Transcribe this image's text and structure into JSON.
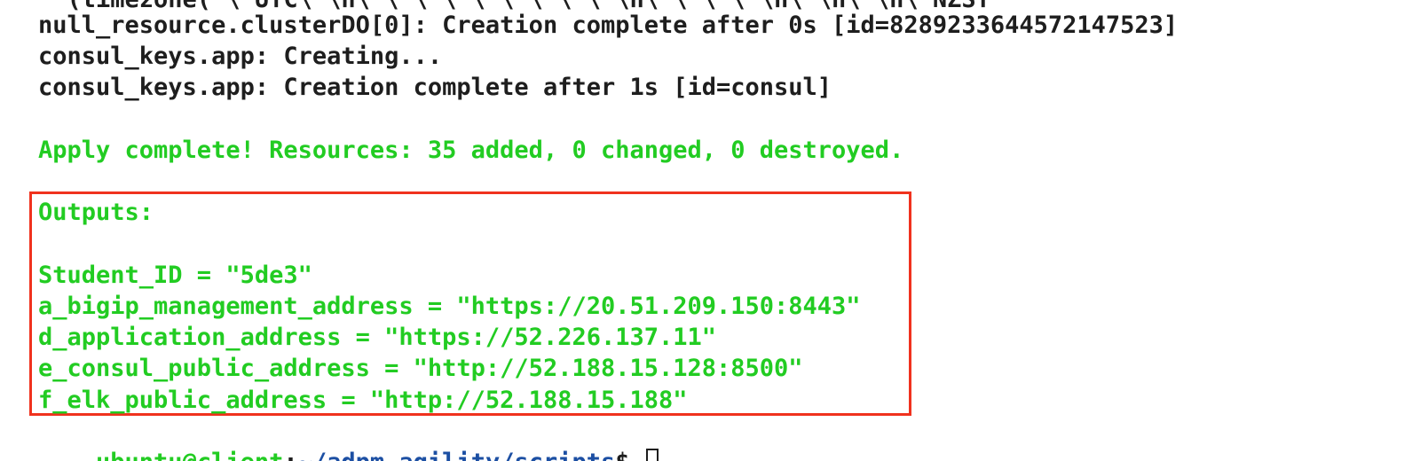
{
  "terminal": {
    "partial_top_line": "  (timezone(\"\\\"UTC\\\"\\n\\\"\\\"\\\"\\\"\\\"\\\"\\\"\\\"\\\"\\n\\\"\\\"\\\"\\\"\\n\\\"\\n\\\"\\n\\\"NZST\"",
    "lines": {
      "null_resource_complete": "null_resource.clusterDO[0]: Creation complete after 0s [id=8289233644572147523]",
      "consul_creating": "consul_keys.app: Creating...",
      "consul_complete": "consul_keys.app: Creation complete after 1s [id=consul]",
      "apply_complete": "Apply complete! Resources: 35 added, 0 changed, 0 destroyed."
    },
    "outputs": {
      "header": "Outputs:",
      "items": [
        "Student_ID = \"5de3\"",
        "a_bigip_management_address = \"https://20.51.209.150:8443\"",
        "d_application_address = \"https://52.226.137.11\"",
        "e_consul_public_address = \"http://52.188.15.128:8500\"",
        "f_elk_public_address = \"http://52.188.15.188\""
      ]
    },
    "prompt": {
      "user_host": "ubuntu@client",
      "separator": ":",
      "path": "~/adpm-agility/scripts",
      "symbol": "$ "
    }
  },
  "colors": {
    "output_green": "#22cc22",
    "path_blue": "#1c4fa3",
    "highlight_red": "#f0321e",
    "text_dark": "#1e1e1e"
  }
}
